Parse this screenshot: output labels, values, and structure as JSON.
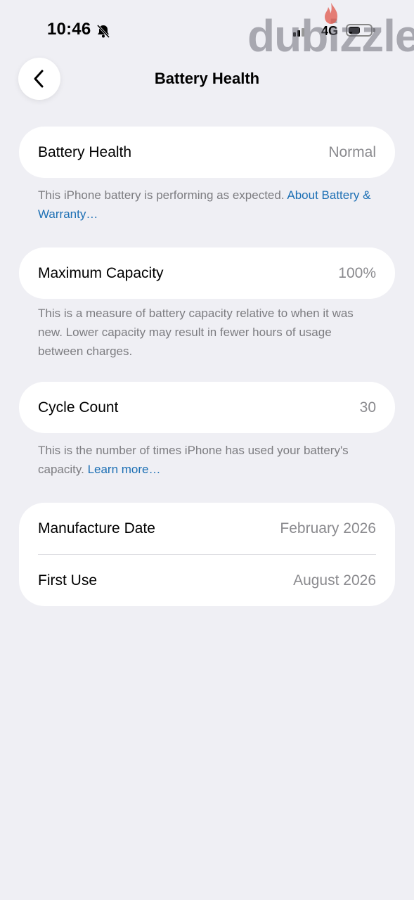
{
  "status_bar": {
    "time": "10:46",
    "network": "4G",
    "icons": [
      "bell-slash-icon",
      "signal-icon",
      "battery-icon"
    ]
  },
  "watermark": {
    "text": "dubizzle"
  },
  "nav": {
    "title": "Battery Health",
    "back_icon": "chevron-left-icon"
  },
  "battery_health": {
    "label": "Battery Health",
    "value": "Normal",
    "note": "This iPhone battery is performing as expected.",
    "link": "About Battery & Warranty…"
  },
  "maximum_capacity": {
    "label": "Maximum Capacity",
    "value": "100%",
    "note": "This is a measure of battery capacity relative to when it was new. Lower capacity may result in fewer hours of usage between charges."
  },
  "cycle_count": {
    "label": "Cycle Count",
    "value": "30",
    "note": "This is the number of times iPhone has used your battery's capacity.",
    "link": "Learn more…"
  },
  "dates": {
    "manufacture_label": "Manufacture Date",
    "manufacture_value": "February 2026",
    "first_use_label": "First Use",
    "first_use_value": "August 2026"
  },
  "colors": {
    "background": "#efeff4",
    "link": "#1c6fb4",
    "secondary_text": "#8a8a8e"
  }
}
